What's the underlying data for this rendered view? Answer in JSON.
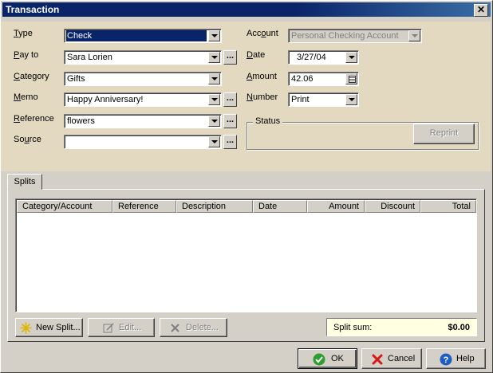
{
  "window": {
    "title": "Transaction",
    "close_glyph": "✕"
  },
  "form": {
    "type": {
      "label": "Type",
      "accel": "T",
      "rest": "ype",
      "value": "Check"
    },
    "pay_to": {
      "label": "Pay to",
      "accel": "P",
      "rest": "ay to",
      "value": "Sara Lorien"
    },
    "category": {
      "label": "Category",
      "accel": "C",
      "rest": "ategory",
      "value": "Gifts"
    },
    "memo": {
      "label": "Memo",
      "accel": "M",
      "rest": "emo",
      "value": "Happy Anniversary!"
    },
    "reference": {
      "label": "Reference",
      "accel": "R",
      "rest": "eference",
      "value": "flowers"
    },
    "source": {
      "label": "Source",
      "pre": "So",
      "accel": "u",
      "rest": "rce",
      "value": ""
    },
    "account": {
      "label": "Account",
      "pre": "Acc",
      "accel": "o",
      "rest": "unt",
      "value": "Personal Checking Account"
    },
    "date": {
      "label": "Date",
      "accel": "D",
      "rest": "ate",
      "value": "3/27/04"
    },
    "amount": {
      "label": "Amount",
      "accel": "A",
      "rest": "mount",
      "value": "42.06"
    },
    "number": {
      "label": "Number",
      "accel": "N",
      "rest": "umber",
      "value": "Print"
    },
    "status": {
      "legend": "Status",
      "reprint_label": "Reprint"
    },
    "ellipsis_glyph": "..."
  },
  "splits": {
    "tab_label": "Splits",
    "columns": [
      "Category/Account",
      "Reference",
      "Description",
      "Date",
      "Amount",
      "Discount",
      "Total"
    ],
    "rows": [],
    "new_split_label": "New Split...",
    "edit_label": "Edit...",
    "delete_label": "Delete...",
    "split_sum_label": "Split sum:",
    "split_sum_value": "$0.00"
  },
  "footer": {
    "ok_label": "OK",
    "cancel_label": "Cancel",
    "help_label": "Help"
  },
  "colors": {
    "title_bar": "#0a246a",
    "form_bg": "#e3d9c1",
    "selection": "#0a246a",
    "sum_bg": "#ffffe1"
  }
}
